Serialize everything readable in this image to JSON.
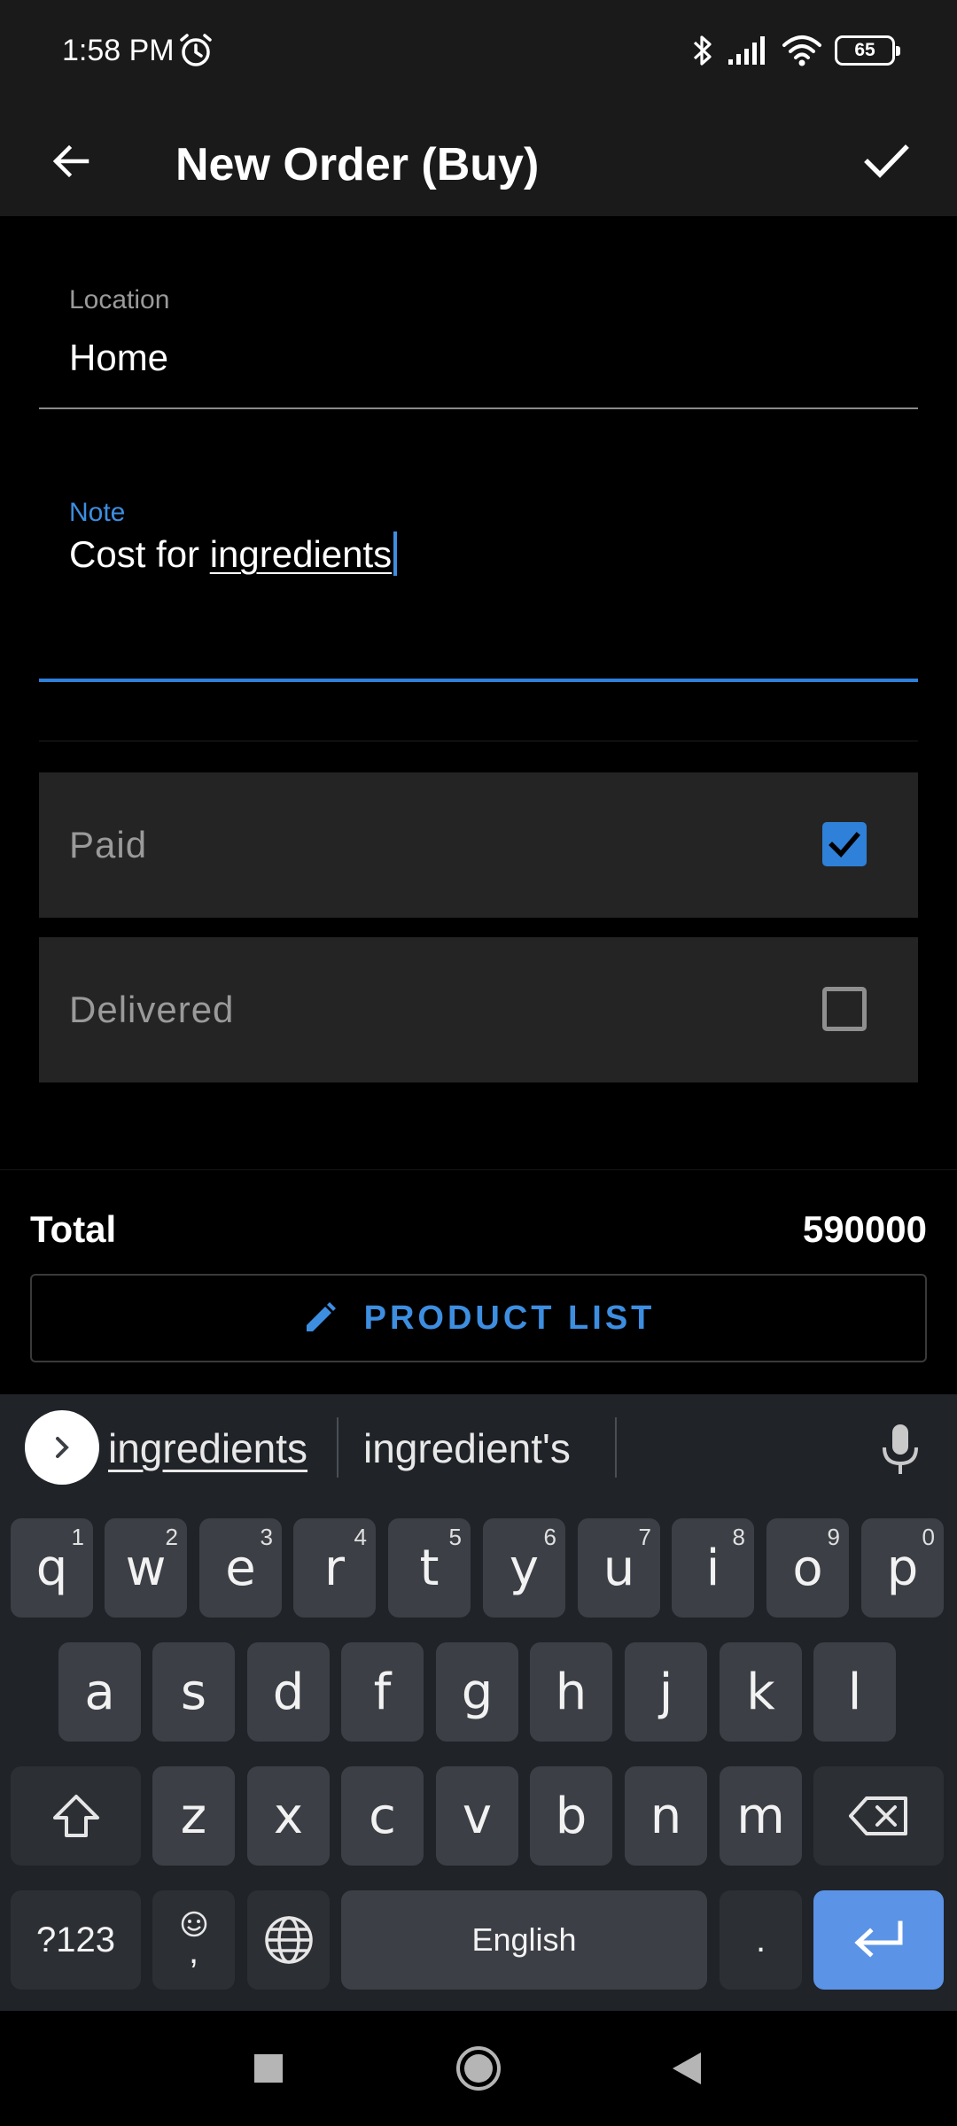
{
  "status": {
    "time": "1:58 PM",
    "battery": "65"
  },
  "appbar": {
    "title": "New Order (Buy)"
  },
  "form": {
    "location": {
      "label": "Location",
      "value": "Home"
    },
    "note": {
      "label": "Note",
      "value_plain": "Cost for ",
      "value_underlined": "ingredients"
    },
    "paid": {
      "label": "Paid",
      "checked": true
    },
    "delivered": {
      "label": "Delivered",
      "checked": false
    }
  },
  "summary": {
    "total_label": "Total",
    "total_value": "590000",
    "product_list_label": "PRODUCT LIST"
  },
  "keyboard": {
    "suggestions": [
      "ingredients",
      "ingredient's"
    ],
    "rows": [
      [
        {
          "k": "q",
          "h": "1"
        },
        {
          "k": "w",
          "h": "2"
        },
        {
          "k": "e",
          "h": "3"
        },
        {
          "k": "r",
          "h": "4"
        },
        {
          "k": "t",
          "h": "5"
        },
        {
          "k": "y",
          "h": "6"
        },
        {
          "k": "u",
          "h": "7"
        },
        {
          "k": "i",
          "h": "8"
        },
        {
          "k": "o",
          "h": "9"
        },
        {
          "k": "p",
          "h": "0"
        }
      ],
      [
        "a",
        "s",
        "d",
        "f",
        "g",
        "h",
        "j",
        "k",
        "l"
      ],
      [
        "z",
        "x",
        "c",
        "v",
        "b",
        "n",
        "m"
      ]
    ],
    "symbols_label": "?123",
    "comma": ",",
    "space_label": "English",
    "period": "."
  },
  "colors": {
    "accent": "#2f80d8",
    "enter_key": "#5b93e6",
    "surface": "#242424"
  }
}
